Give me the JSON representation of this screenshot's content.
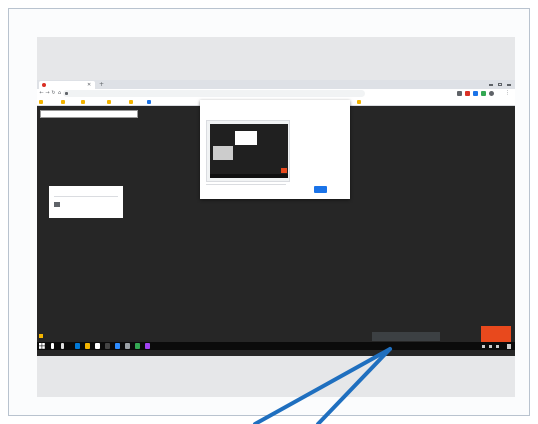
{
  "colors": {
    "frame_border": "#b9c3cf",
    "screen_background": "#262626",
    "pointer_lines": "#1f6fbf",
    "share_button": "#1a73e8",
    "accent_orange": "#e8491d",
    "taskbar": "#0b0b0b"
  },
  "browser": {
    "tab_title": "",
    "address": "",
    "bookmarks": [
      {
        "label": "",
        "icon": "bookmark-icon"
      },
      {
        "label": "",
        "icon": "bookmark-icon"
      },
      {
        "label": "",
        "icon": "bookmark-icon"
      },
      {
        "label": "",
        "icon": "bookmark-icon"
      },
      {
        "label": "",
        "icon": "bookmark-icon"
      },
      {
        "label": "",
        "icon": "bookmark-icon"
      }
    ],
    "other_bookmarks": ""
  },
  "page": {
    "share_banner": ""
  },
  "share_dialog": {
    "title": "",
    "description": "",
    "link": "",
    "share_label": "",
    "cancel_label": ""
  },
  "side_card": {
    "title": "",
    "text": ""
  },
  "camera_toast": "",
  "orange_button": "",
  "download_label": "",
  "taskbar": {
    "time": "",
    "date": ""
  }
}
